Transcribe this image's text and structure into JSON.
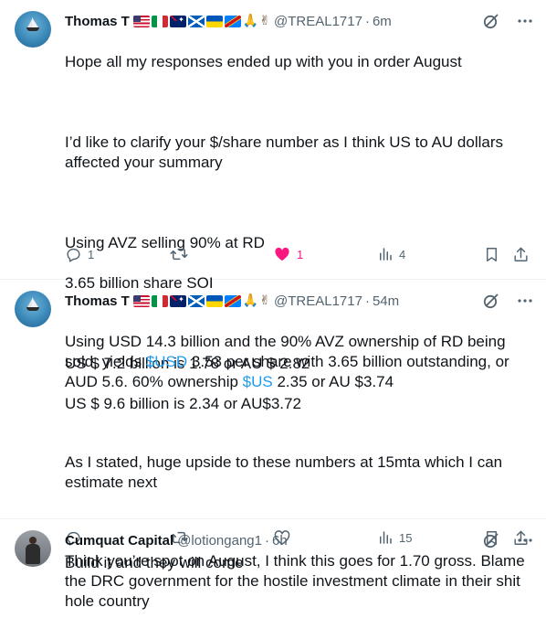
{
  "tweets": [
    {
      "name": "Thomas T",
      "handle": "@TREAL1717",
      "separator": "·",
      "time": "6m",
      "lines": [
        "Hope all my responses ended up with you in order August",
        "",
        "I’d like to clarify your $/share number as I think US to AU dollars affected your summary",
        "",
        "Using AVZ selling 90% at RD",
        "3.65 billion share SOI",
        "",
        "US $ 7.2 billion is 1.78 or AU $ 2.82",
        "US $ 9.6 billion is 2.34 or AU$3.72"
      ],
      "replies": "1",
      "retweets": "",
      "likes": "1",
      "liked": true,
      "views": "4"
    },
    {
      "name": "Thomas T",
      "handle": "@TREAL1717",
      "separator": "·",
      "time": "54m",
      "text_a": "Using USD 14.3 billion and the 90% AVZ ownership of RD being sold, yields ",
      "cashtag_1": "$USD",
      "text_b": " 3.53 per share with 3.65 billion outstanding, or AUD 5.6. 60% ownership ",
      "cashtag_2": "$US",
      "text_c": " 2.35 or AU $3.74",
      "para2": "As I stated, huge upside to these numbers at 15mta which I can estimate next",
      "para3": "Build it and they will come",
      "replies": "",
      "retweets": "",
      "likes": "",
      "liked": false,
      "views": "15"
    },
    {
      "name": "Cumquat Capital",
      "handle": "@lotiongang1",
      "separator": "·",
      "time": "6h",
      "text": "Think you’re spot on August, I think this goes for 1.70 gross. Blame the DRC government for the hostile investment climate in their shit hole country"
    }
  ],
  "emoji_set": [
    "🇺🇸",
    "🇮🇹",
    "🇦🇺",
    "🏴",
    "🇺🇦",
    "🇨🇩",
    "🙏🏾",
    "✌🏾"
  ],
  "colors": {
    "link": "#1d9bf0",
    "like_active": "#f91880",
    "muted": "#536471",
    "text": "#0f1419"
  }
}
